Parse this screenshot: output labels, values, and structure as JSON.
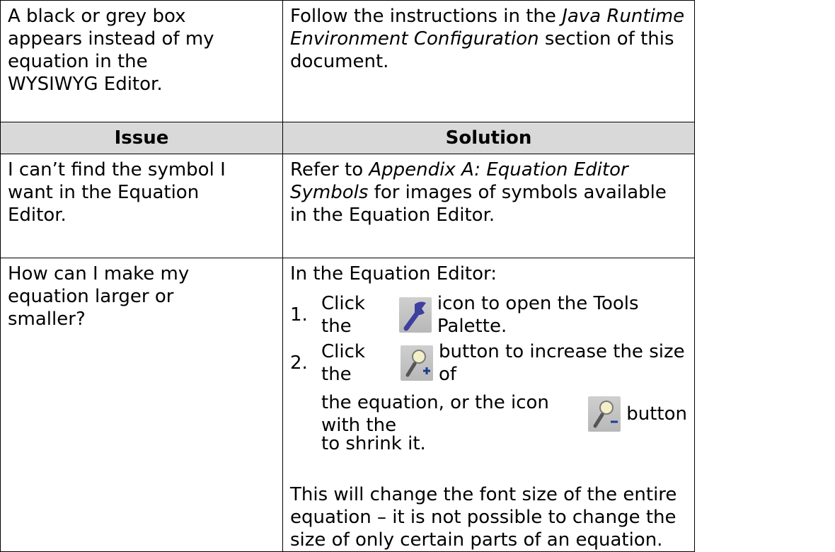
{
  "table": {
    "row1": {
      "issue": [
        "A black or grey box",
        "appears instead of my",
        "equation in the",
        "WYSIWYG Editor."
      ],
      "solution_prefix": "Follow the instructions in the ",
      "solution_link": "Java Runtime Environment Configuration",
      "solution_suffix": " section of this document."
    },
    "header": {
      "issue": "Issue",
      "solution": "Solution"
    },
    "row2": {
      "issue": [
        "I can’t find the symbol I",
        "want in the Equation",
        "Editor."
      ],
      "solution_prefix": "Refer to ",
      "solution_link": "Appendix A: Equation Editor Symbols",
      "solution_suffix": " for images of symbols available in the Equation Editor."
    },
    "row3": {
      "issue": [
        "How can I make my",
        "equation larger or",
        "smaller?"
      ],
      "intro": "In the Equation Editor:",
      "step1_num": "1.",
      "step1_before": "Click the",
      "step1_after": "icon to open the Tools Palette.",
      "step2_num": "2.",
      "step2_before": "Click the",
      "step2_after": "button to increase the size of",
      "step2b_before": "the equation, or the icon with the",
      "step2b_after": "button",
      "step2c": "to shrink it.",
      "note": "This will change the font size of the entire equation – it is not possible to change the size of only certain parts of an equation."
    }
  },
  "icons": {
    "tools": "wrench-icon",
    "zoom_in": "zoom-in-icon",
    "zoom_out": "zoom-out-icon",
    "icon_bg": "#c4c4c4",
    "icon_accent": "#3f3f9f"
  }
}
